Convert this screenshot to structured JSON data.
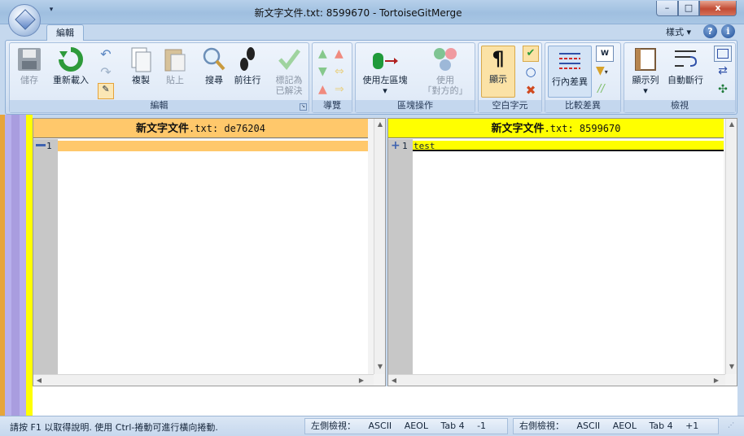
{
  "window": {
    "title": "新文字文件.txt: 8599670 - TortoiseGitMerge",
    "minimize": "–",
    "maximize": "□",
    "close": "x"
  },
  "ribbon": {
    "tab": "編輯",
    "style_menu": "樣式 ▾",
    "groups": {
      "edit": {
        "label": "編輯",
        "save": "儲存",
        "reload": "重新載入",
        "copy": "複製",
        "paste": "貼上",
        "search": "搜尋",
        "goto_line": "前往行",
        "mark_resolved": [
          "標記為",
          "已解決"
        ]
      },
      "navigate": {
        "label": "導覽"
      },
      "block": {
        "label": "區塊操作",
        "use_left": "使用左區塊",
        "use_other": [
          "使用",
          "「對方的」"
        ]
      },
      "whitespace": {
        "label": "空白字元",
        "show": "顯示"
      },
      "diff": {
        "label": "比較差異",
        "inline": "行內差異"
      },
      "view": {
        "label": "檢視",
        "show_lines": "顯示列",
        "word_wrap": "自動斷行"
      }
    }
  },
  "left_pane": {
    "filename": "新文字文件",
    "hash": ".txt: de76204",
    "lines": [
      {
        "no": "1",
        "text": ""
      }
    ]
  },
  "right_pane": {
    "filename": "新文字文件",
    "hash": ".txt: 8599670",
    "lines": [
      {
        "no": "1",
        "text": "test"
      }
    ]
  },
  "status": {
    "message": "請按 F1 以取得說明. 使用 Ctrl-捲動可進行橫向捲動.",
    "left_view_label": "左側檢視：",
    "right_view_label": "右側檢視：",
    "left": {
      "encoding": "ASCII",
      "eol": "AEOL",
      "tab": "Tab 4",
      "count": "-1"
    },
    "right": {
      "encoding": "ASCII",
      "eol": "AEOL",
      "tab": "Tab 4",
      "count": "+1"
    }
  },
  "colors": {
    "left_header": "#ffc86b",
    "right_header": "#ffff00",
    "removed_line": "#ffc86b",
    "added_line": "#ffff00",
    "ribbon_bg": "#dae6f4"
  }
}
